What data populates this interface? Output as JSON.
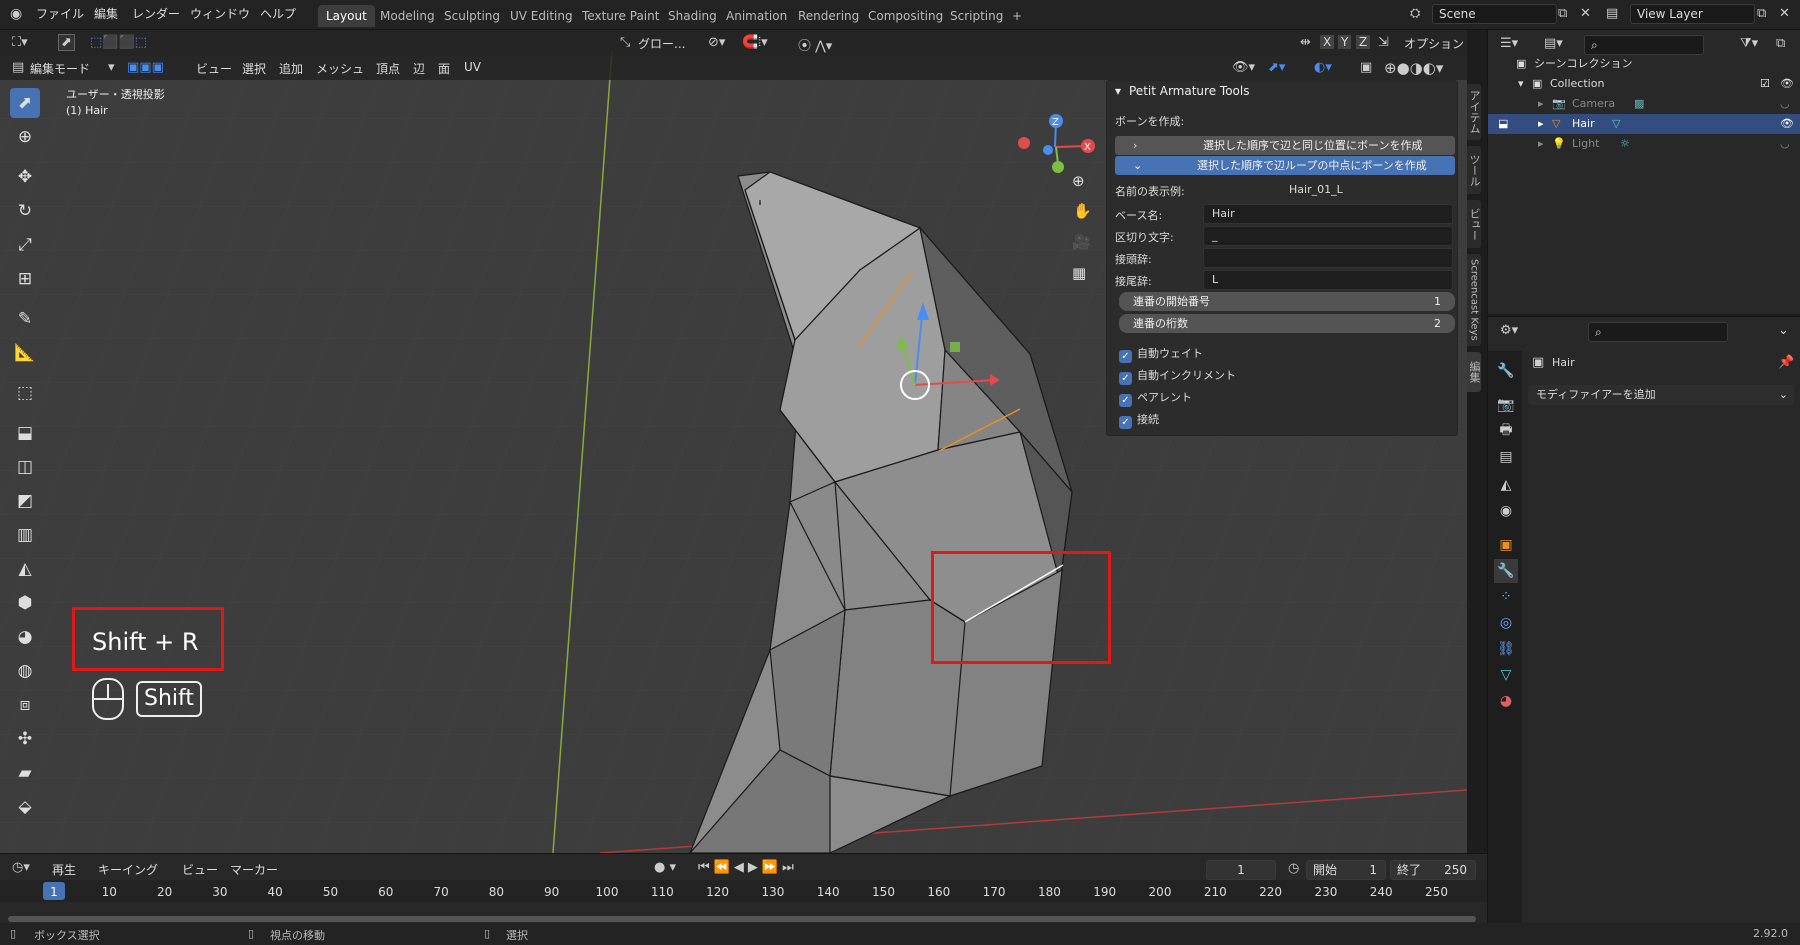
{
  "topbar": {
    "menus": [
      "ファイル",
      "編集",
      "レンダー",
      "ウィンドウ",
      "ヘルプ"
    ],
    "workspaces": [
      "Layout",
      "Modeling",
      "Sculpting",
      "UV Editing",
      "Texture Paint",
      "Shading",
      "Animation",
      "Rendering",
      "Compositing",
      "Scripting"
    ],
    "active_workspace": "Layout",
    "add_tab": "+",
    "scene": "Scene",
    "view_layer": "View Layer"
  },
  "viewport_header": {
    "mode": "編集モード",
    "menus": [
      "ビュー",
      "選択",
      "追加",
      "メッシュ",
      "頂点",
      "辺",
      "面",
      "UV"
    ],
    "transform_orientation": "グロー...",
    "options": "オプション",
    "axis_x": "X",
    "axis_y": "Y",
    "axis_z": "Z"
  },
  "viewport": {
    "view_name": "ユーザー・透視投影",
    "object_name": "(1) Hair",
    "gizmo_x": "X",
    "gizmo_z": "Z"
  },
  "screencast": {
    "shortcut": "Shift + R",
    "modifier": "Shift"
  },
  "npanel": {
    "title": "Petit Armature Tools",
    "create_bone_label": "ボーンを作成:",
    "btn1": "選択した順序で辺と同じ位置にボーンを作成",
    "btn2": "選択した順序で辺ループの中点にボーンを作成",
    "example_label": "名前の表示例:",
    "example_value": "Hair_01_L",
    "base_name_label": "ベース名:",
    "base_name_value": "Hair",
    "separator_label": "区切り文字:",
    "separator_value": "_",
    "prefix_label": "接頭辞:",
    "prefix_value": "",
    "suffix_label": "接尾辞:",
    "suffix_value": "L",
    "start_number_label": "連番の開始番号",
    "start_number_value": "1",
    "digits_label": "連番の桁数",
    "digits_value": "2",
    "checkboxes": [
      "自動ウェイト",
      "自動インクリメント",
      "ペアレント",
      "接続"
    ]
  },
  "side_tabs": [
    "アイテム",
    "ツール",
    "ビュー",
    "Screencast Keys",
    "編集"
  ],
  "outliner": {
    "scene_collection": "シーンコレクション",
    "collection": "Collection",
    "items": [
      "Camera",
      "Hair",
      "Light"
    ]
  },
  "properties": {
    "object_name": "Hair",
    "add_modifier": "モディファイアーを追加"
  },
  "timeline": {
    "menus": [
      "再生",
      "キーイング",
      "ビュー",
      "マーカー"
    ],
    "current_frame": "1",
    "start_label": "開始",
    "start_value": "1",
    "end_label": "終了",
    "end_value": "250",
    "ticks": [
      "1",
      "10",
      "20",
      "30",
      "40",
      "50",
      "60",
      "70",
      "80",
      "90",
      "100",
      "110",
      "120",
      "130",
      "140",
      "150",
      "160",
      "170",
      "180",
      "190",
      "200",
      "210",
      "220",
      "230",
      "240",
      "250"
    ]
  },
  "statusbar": {
    "left": "ボックス選択",
    "middle": "視点の移動",
    "right": "選択",
    "version": "2.92.0"
  }
}
